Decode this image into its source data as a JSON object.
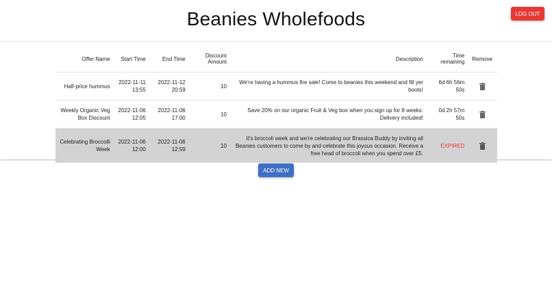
{
  "app": {
    "title": "Beanies Wholefoods",
    "logout_label": "LOG OUT"
  },
  "table": {
    "headers": {
      "name": "Offer Name",
      "start": "Start Time",
      "end": "End Time",
      "amount": "Discount Amount",
      "description": "Description",
      "time_remaining": "Time remaining",
      "remove": "Remove"
    },
    "rows": [
      {
        "name": "Half-price hummus",
        "start": "2022-11-11 13:55",
        "end": "2022-11-12 20:59",
        "amount": "10",
        "description": "We're having a hummus fire sale! Come to beanies this weekend and fill yer boots!",
        "time_remaining": "6d 6h 56m 50s"
      },
      {
        "name": "Weekly Organic Veg Box Discount",
        "start": "2022-11-06 12:05",
        "end": "2022-11-06 17:00",
        "amount": "10",
        "description": "Save 20% on our organic Fruit & Veg box when you sign up for 8 weeks. Delivery included!",
        "time_remaining": "0d 2h 57m 50s"
      },
      {
        "name": "Celebrating Broccolli Week",
        "start": "2022-11-06 12:00",
        "end": "2022-11-06 12:59",
        "amount": "10",
        "description": "It's broccoli week and we're celebrating our Brassica Buddy by inviting all Beanies customers to come by and celebrate this joyous occasion. Receive a free head of broccoli when you spend over £5.",
        "time_remaining": "EXPIRED"
      }
    ]
  },
  "add_new_label": "ADD NEW",
  "colors": {
    "danger": "#e53935",
    "primary": "#3f6fc5",
    "expired_row": "#d3d3d3"
  },
  "icons": {
    "remove": "trash-icon"
  }
}
